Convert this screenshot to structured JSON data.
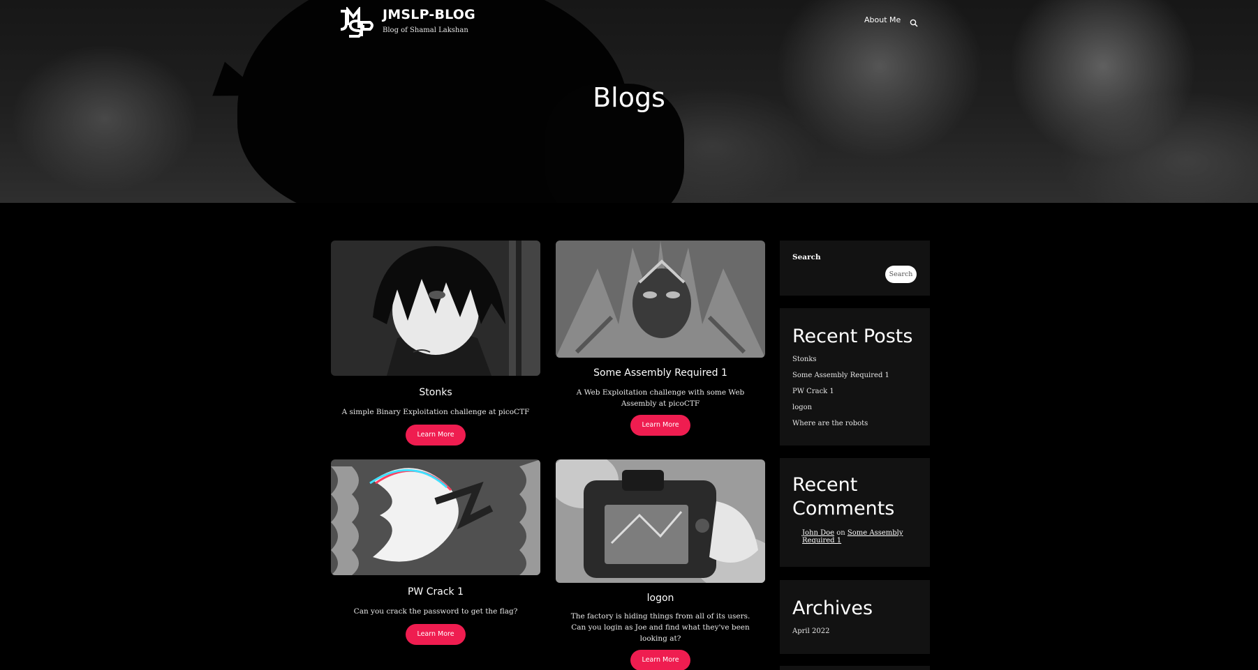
{
  "site": {
    "title": "JMSLP-BLOG",
    "description": "Blog of Shamal Lakshan",
    "logo_text": "JMSLP"
  },
  "nav": {
    "about": "About Me",
    "search_icon": "search-icon"
  },
  "hero": {
    "title": "Blogs"
  },
  "posts": [
    {
      "title": "Stonks",
      "description": "A simple Binary Exploitation challenge at picoCTF",
      "button": "Learn More"
    },
    {
      "title": "Some Assembly Required 1",
      "description": "A Web Exploitation challenge with some Web Assembly at picoCTF",
      "button": "Learn More"
    },
    {
      "title": "PW Crack 1",
      "description": "Can you crack the password to get the flag?",
      "button": "Learn More"
    },
    {
      "title": "logon",
      "description": "The factory is hiding things from all of its users. Can you login as Joe and find what they've been looking at?",
      "button": "Learn More"
    }
  ],
  "sidebar": {
    "search": {
      "label": "Search",
      "button": "Search"
    },
    "recent_posts": {
      "title": "Recent Posts",
      "items": [
        "Stonks",
        "Some Assembly Required 1",
        "PW Crack 1",
        "logon",
        "Where are the robots"
      ]
    },
    "recent_comments": {
      "title": "Recent Comments",
      "author": "John Doe",
      "on": "on",
      "post": "Some Assembly Required 1"
    },
    "archives": {
      "title": "Archives",
      "items": [
        "April 2022"
      ]
    }
  },
  "colors": {
    "accent": "#ef1d50",
    "widget_bg": "#121212",
    "page_bg": "#000000"
  }
}
